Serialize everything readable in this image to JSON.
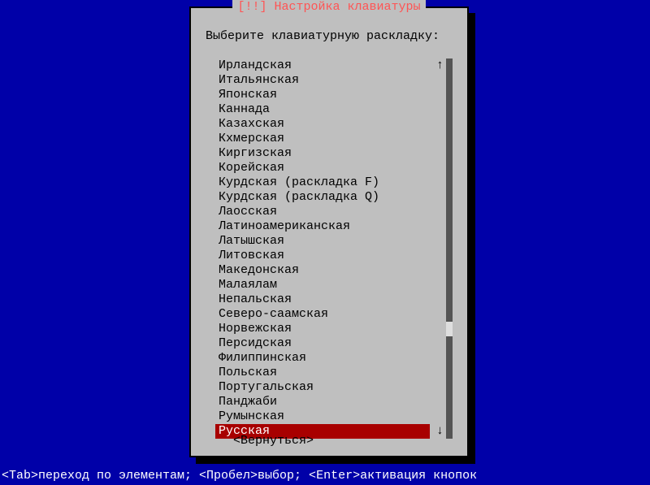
{
  "dialog": {
    "title": "[!!] Настройка клавиатуры",
    "prompt": "Выберите клавиатурную раскладку:",
    "back_label": "<Вернуться>",
    "scroll_up": "↑",
    "scroll_down": "↓"
  },
  "items": [
    {
      "label": "Ирландская",
      "selected": false
    },
    {
      "label": "Итальянская",
      "selected": false
    },
    {
      "label": "Японская",
      "selected": false
    },
    {
      "label": "Каннада",
      "selected": false
    },
    {
      "label": "Казахская",
      "selected": false
    },
    {
      "label": "Кхмерская",
      "selected": false
    },
    {
      "label": "Киргизская",
      "selected": false
    },
    {
      "label": "Корейская",
      "selected": false
    },
    {
      "label": "Курдская (раскладка F)",
      "selected": false
    },
    {
      "label": "Курдская (раскладка Q)",
      "selected": false
    },
    {
      "label": "Лаосская",
      "selected": false
    },
    {
      "label": "Латиноамериканская",
      "selected": false
    },
    {
      "label": "Латышская",
      "selected": false
    },
    {
      "label": "Литовская",
      "selected": false
    },
    {
      "label": "Македонская",
      "selected": false
    },
    {
      "label": "Малаялам",
      "selected": false
    },
    {
      "label": "Непальская",
      "selected": false
    },
    {
      "label": "Северо-саамская",
      "selected": false
    },
    {
      "label": "Норвежская",
      "selected": false
    },
    {
      "label": "Персидская",
      "selected": false
    },
    {
      "label": "Филиппинская",
      "selected": false
    },
    {
      "label": "Польская",
      "selected": false
    },
    {
      "label": "Португальская",
      "selected": false
    },
    {
      "label": "Панджаби",
      "selected": false
    },
    {
      "label": "Румынская",
      "selected": false
    },
    {
      "label": "Русская",
      "selected": true
    }
  ],
  "help_bar": "<Tab>переход по элементам; <Пробел>выбор; <Enter>активация кнопок"
}
